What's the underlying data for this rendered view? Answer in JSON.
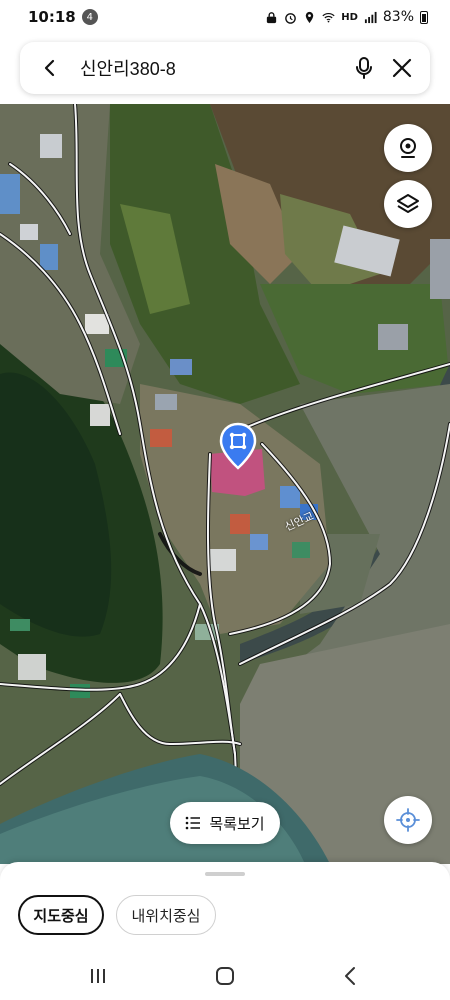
{
  "status_bar": {
    "time": "10:18",
    "notification_count": "4",
    "network": "HD",
    "battery": "83%"
  },
  "search": {
    "query": "신안리380-8"
  },
  "map": {
    "road_label": "신안교",
    "marker_color": "#3a7bf0",
    "parcel_color": "#d14a86"
  },
  "list_button": {
    "label": "목록보기"
  },
  "bottom_sheet": {
    "chips": [
      {
        "label": "지도중심",
        "active": true
      },
      {
        "label": "내위치중심",
        "active": false
      }
    ]
  },
  "icons": {
    "back": "chevron-left-icon",
    "mic": "mic-icon",
    "close": "close-icon",
    "street_view": "street-view-icon",
    "layers": "layers-icon",
    "locate": "locate-icon",
    "list": "list-icon"
  }
}
